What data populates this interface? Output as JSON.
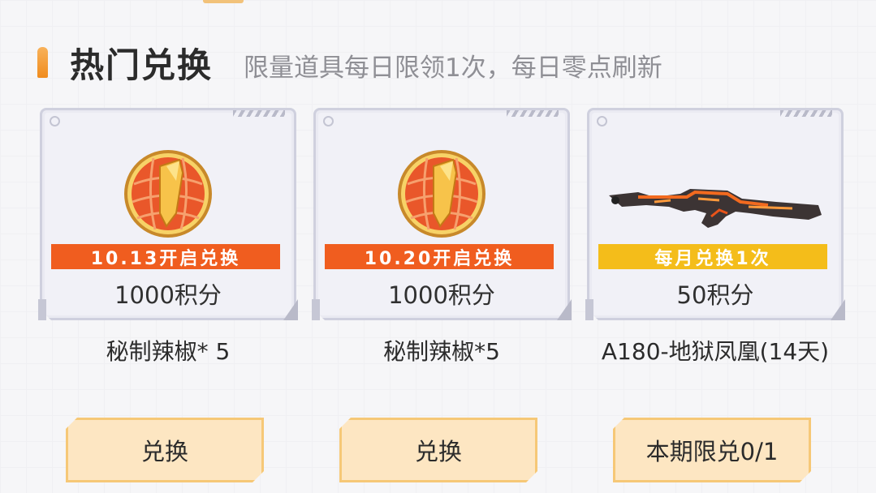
{
  "section": {
    "title": "热门兑换",
    "subtitle": "限量道具每日限领1次，每日零点刷新"
  },
  "items": [
    {
      "banner": "10.13开启兑换",
      "banner_color": "#f05d1f",
      "price": "1000积分",
      "name": "秘制辣椒* 5",
      "icon": "chili-coin-icon",
      "button": "兑换"
    },
    {
      "banner": "10.20开启兑换",
      "banner_color": "#f05d1f",
      "price": "1000积分",
      "name": "秘制辣椒*5",
      "icon": "chili-coin-icon",
      "button": "兑换"
    },
    {
      "banner": "每月兑换1次",
      "banner_color": "#f4bd1a",
      "price": "50积分",
      "name": "A180-地狱凤凰(14天)",
      "icon": "rifle-icon",
      "button": "本期限兑0/1"
    }
  ]
}
